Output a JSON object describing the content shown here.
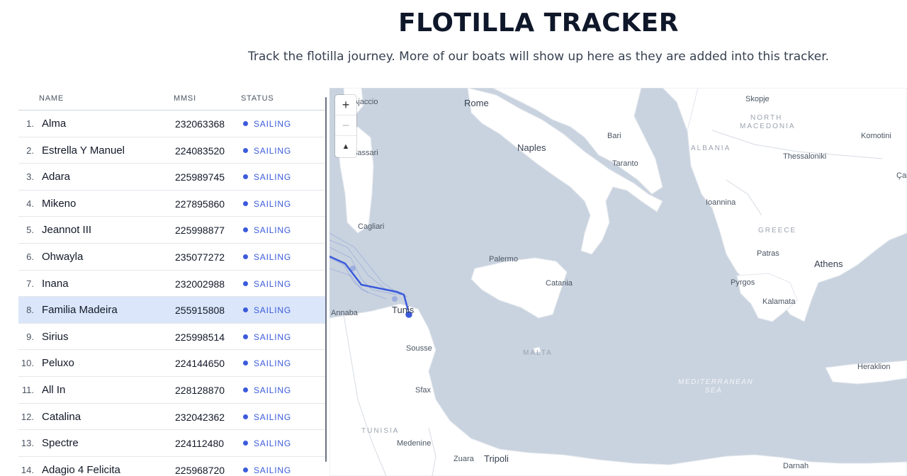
{
  "header": {
    "title": "FLOTILLA TRACKER",
    "subtitle": "Track the flotilla journey. More of our boats will show up here as they are added into this tracker."
  },
  "table": {
    "columns": [
      "NAME",
      "MMSI",
      "STATUS"
    ],
    "selected_index": 7,
    "status_color": "#3b5bdb",
    "rows": [
      {
        "index": "1.",
        "name": "Alma",
        "mmsi": "232063368",
        "status": "SAILING"
      },
      {
        "index": "2.",
        "name": "Estrella Y Manuel",
        "mmsi": "224083520",
        "status": "SAILING"
      },
      {
        "index": "3.",
        "name": "Adara",
        "mmsi": "225989745",
        "status": "SAILING"
      },
      {
        "index": "4.",
        "name": "Mikeno",
        "mmsi": "227895860",
        "status": "SAILING"
      },
      {
        "index": "5.",
        "name": "Jeannot III",
        "mmsi": "225998877",
        "status": "SAILING"
      },
      {
        "index": "6.",
        "name": "Ohwayla",
        "mmsi": "235077272",
        "status": "SAILING"
      },
      {
        "index": "7.",
        "name": "Inana",
        "mmsi": "232002988",
        "status": "SAILING"
      },
      {
        "index": "8.",
        "name": "Familia Madeira",
        "mmsi": "255915808",
        "status": "SAILING"
      },
      {
        "index": "9.",
        "name": "Sirius",
        "mmsi": "225998514",
        "status": "SAILING"
      },
      {
        "index": "10.",
        "name": "Peluxo",
        "mmsi": "224144650",
        "status": "SAILING"
      },
      {
        "index": "11.",
        "name": "All In",
        "mmsi": "228128870",
        "status": "SAILING"
      },
      {
        "index": "12.",
        "name": "Catalina",
        "mmsi": "232042362",
        "status": "SAILING"
      },
      {
        "index": "13.",
        "name": "Spectre",
        "mmsi": "224112480",
        "status": "SAILING"
      },
      {
        "index": "14.",
        "name": "Adagio 4 Felicita",
        "mmsi": "225968720",
        "status": "SAILING"
      }
    ]
  },
  "map": {
    "controls": {
      "zoom_in": "+",
      "zoom_out": "−",
      "compass": "▲"
    },
    "colors": {
      "sea": "#c9d3df",
      "land": "#ffffff",
      "track": "#3b5bdb"
    },
    "labels": {
      "rome": "Rome",
      "naples": "Naples",
      "bari": "Bari",
      "taranto": "Taranto",
      "skopje": "Skopje",
      "north_macedonia": "NORTH MACEDONIA",
      "komotini": "Komotini",
      "albania": "ALBANIA",
      "thessaloniki": "Thessaloniki",
      "ioannina": "Ioannina",
      "greece": "GREECE",
      "patras": "Patras",
      "athens": "Athens",
      "pyrgos": "Pyrgos",
      "kalamata": "Kalamata",
      "cagliari": "Cagliari",
      "sassari": "Sassari",
      "ajaccio": "Ajaccio",
      "palermo": "Palermo",
      "catania": "Catania",
      "malta": "MALTA",
      "tunis": "Tunis",
      "annaba": "Annaba",
      "sousse": "Sousse",
      "sfax": "Sfax",
      "tunisia": "TUNISIA",
      "medenine": "Medenine",
      "zuara": "Zuara",
      "tripoli": "Tripoli",
      "heraklion": "Heraklion",
      "mediterranean_sea": "MEDITERRANEAN SEA",
      "darnah": "Darnah",
      "canakkale": "Çan"
    }
  }
}
